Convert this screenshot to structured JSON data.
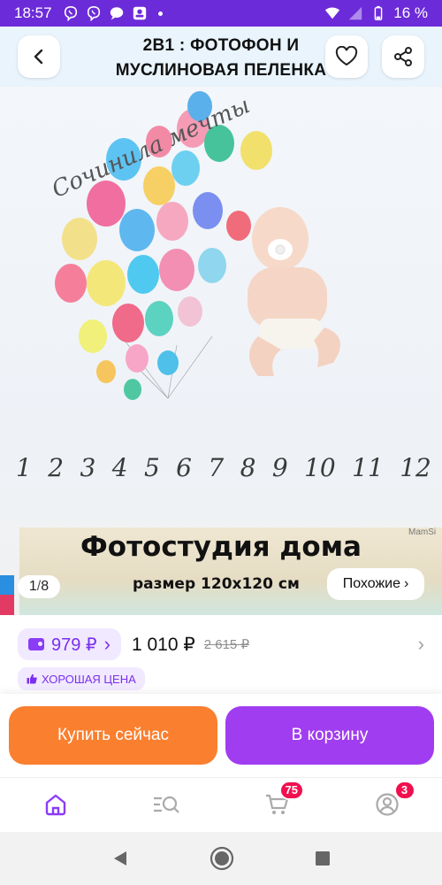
{
  "status_bar": {
    "time": "18:57",
    "battery": "16 %",
    "icons": [
      "viber-icon",
      "viber-icon",
      "chat-icon",
      "app-icon",
      "wifi-icon",
      "signal-icon",
      "battery-icon"
    ]
  },
  "header": {
    "title_line1": "2В1 : ФОТОФОН И",
    "title_line2": "МУСЛИНОВАЯ ПЕЛЕНКА"
  },
  "image": {
    "script_text": "Сочинила мечты",
    "numbers": [
      "1",
      "2",
      "3",
      "4",
      "5",
      "6",
      "7",
      "8",
      "9",
      "10",
      "11",
      "12"
    ],
    "caption_title": "Фотостудия дома",
    "caption_size": "размер 120х120 см",
    "watermark": "MamSi",
    "pager_current": "1",
    "pager_sep": "/",
    "pager_total": "8",
    "similar_label": "Похожие",
    "similar_chevron": "›"
  },
  "price": {
    "wallet_price": "979 ₽",
    "wallet_chevron": "›",
    "regular_price": "1 010 ₽",
    "old_price": "2 615 ₽",
    "row_chevron": "›"
  },
  "good_price_label": "ХОРОШАЯ ЦЕНА",
  "actions": {
    "buy_now": "Купить сейчас",
    "to_cart": "В корзину"
  },
  "bottom_nav": {
    "cart_badge": "75",
    "profile_badge": "3"
  },
  "colors": {
    "brand_purple": "#6c2bd9",
    "accent_orange": "#fa7f2f",
    "accent_violet": "#a13df0",
    "badge_red": "#f0104f"
  }
}
